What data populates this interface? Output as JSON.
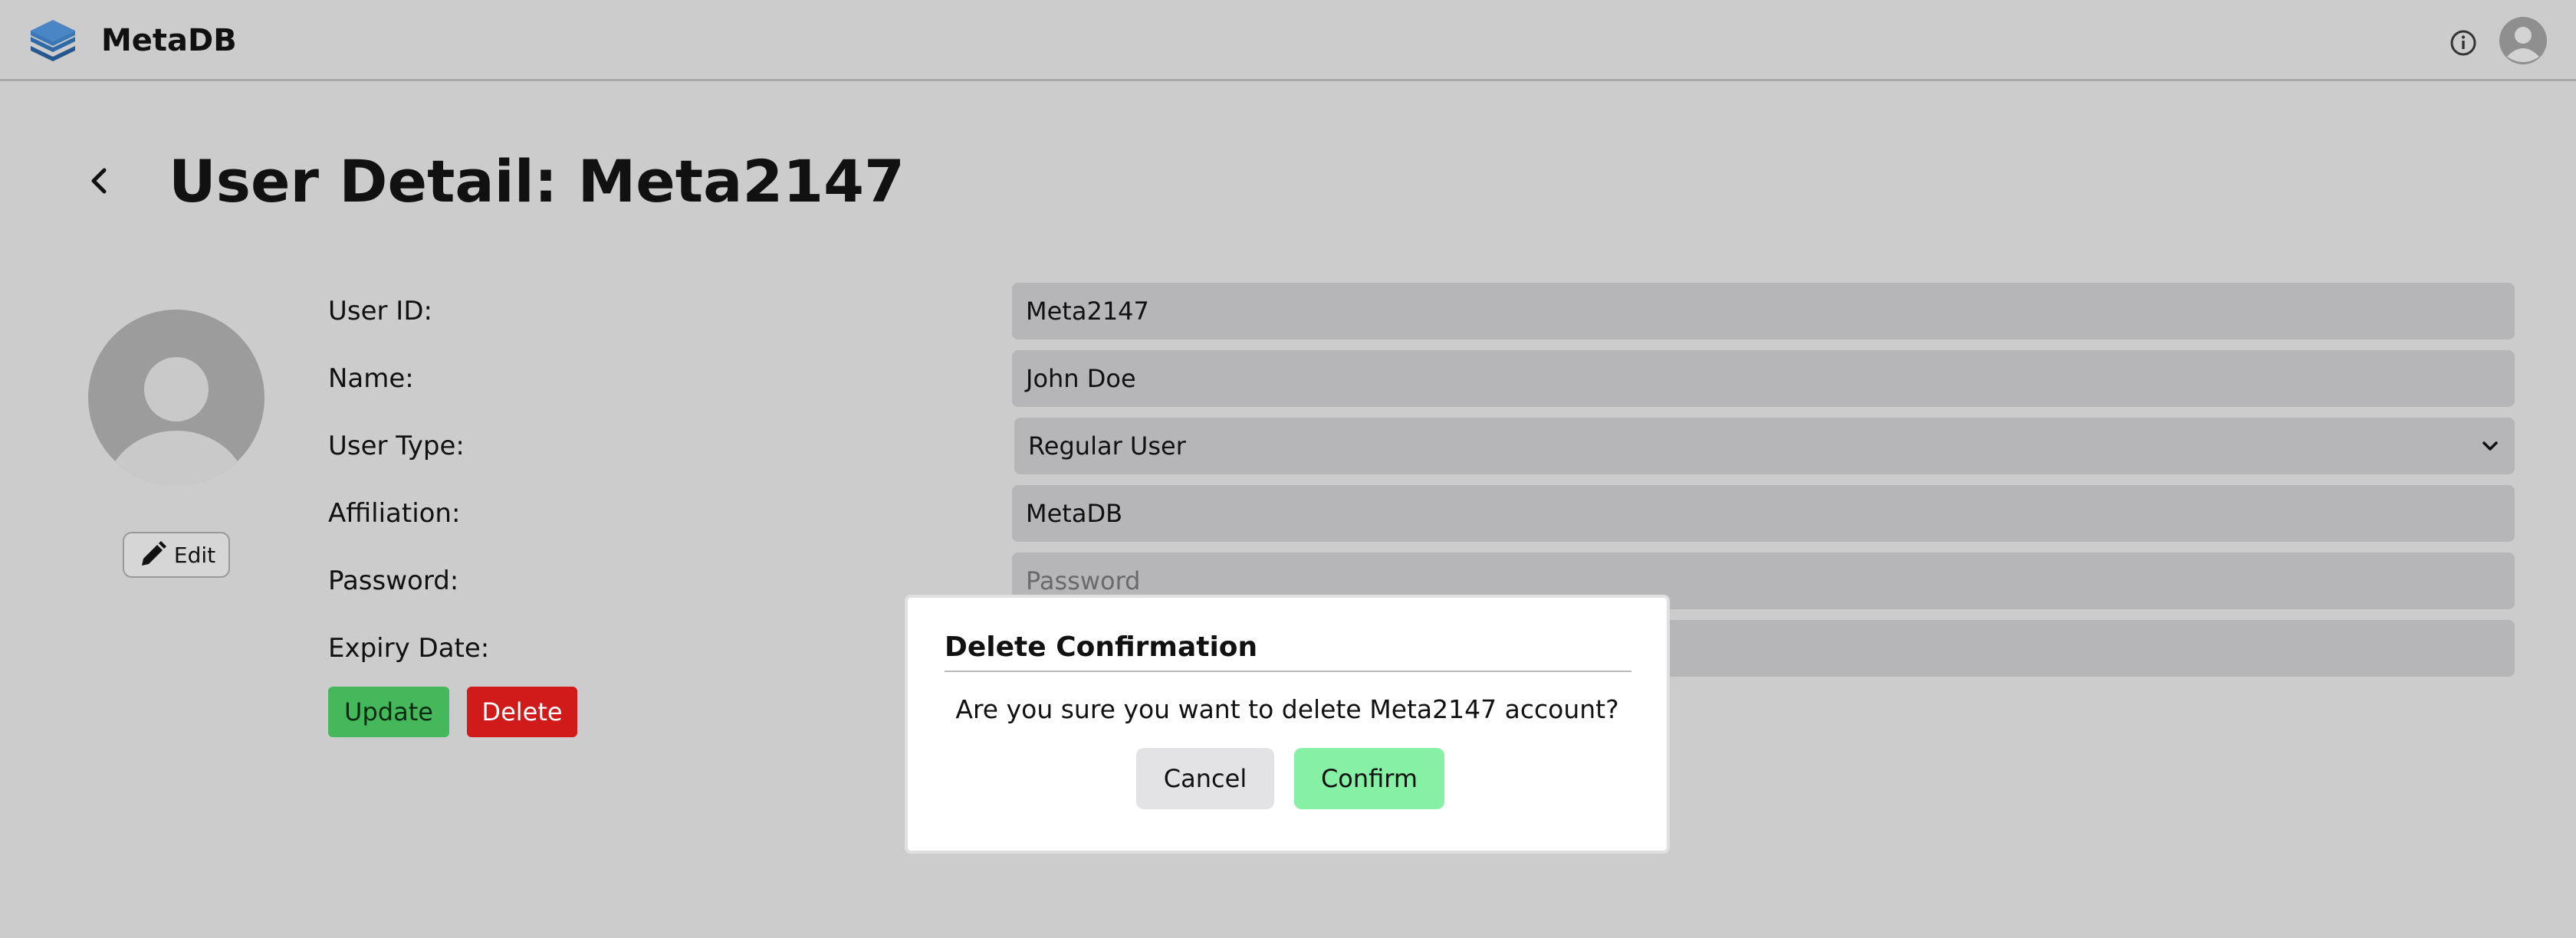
{
  "app": {
    "brand": "MetaDB",
    "logo_icon": "stacked-layers-icon",
    "info_icon": "info-icon",
    "avatar_icon": "user-avatar-icon"
  },
  "page": {
    "title": "User Detail: Meta2147",
    "back_icon": "chevron-left-icon"
  },
  "profile": {
    "avatar_icon": "user-avatar-icon",
    "edit_label": "Edit",
    "edit_icon": "pencil-icon"
  },
  "form": {
    "user_id": {
      "label": "User ID:",
      "value": "Meta2147"
    },
    "name": {
      "label": "Name:",
      "value": "John Doe"
    },
    "user_type": {
      "label": "User Type:",
      "value": "Regular User"
    },
    "affiliation": {
      "label": "Affiliation:",
      "value": "MetaDB"
    },
    "password": {
      "label": "Password:",
      "value": "",
      "placeholder": "Password"
    },
    "expiry_date": {
      "label": "Expiry Date:",
      "value": ""
    },
    "update_label": "Update",
    "delete_label": "Delete"
  },
  "modal": {
    "title": "Delete Confirmation",
    "message": "Are you sure you want to delete Meta2147 account?",
    "cancel_label": "Cancel",
    "confirm_label": "Confirm"
  },
  "colors": {
    "background": "#cccccc",
    "input": "#b6b6b8",
    "update": "#45b85c",
    "delete": "#d11a1a",
    "confirm": "#86f0a4",
    "cancel": "#e3e3e6"
  }
}
